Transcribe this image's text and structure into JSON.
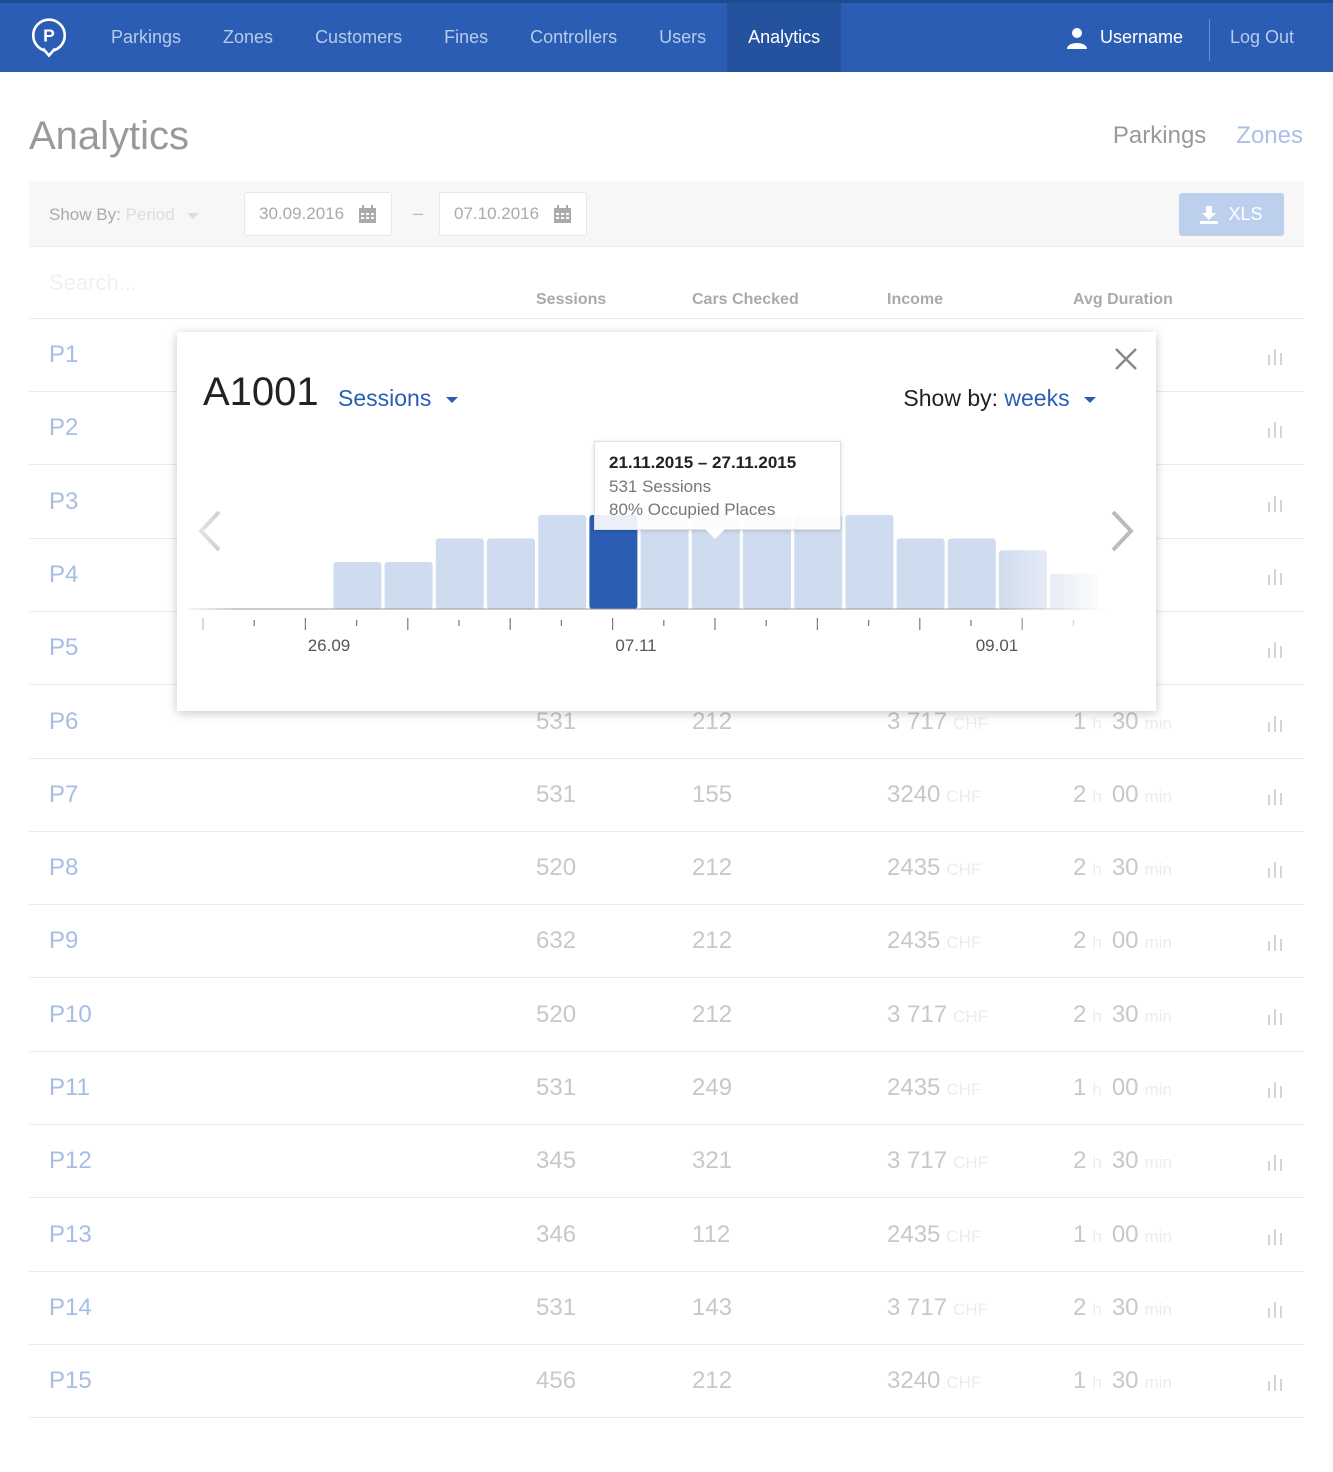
{
  "nav": {
    "items": [
      {
        "label": "Parkings",
        "active": false
      },
      {
        "label": "Zones",
        "active": false
      },
      {
        "label": "Customers",
        "active": false
      },
      {
        "label": "Fines",
        "active": false
      },
      {
        "label": "Controllers",
        "active": false
      },
      {
        "label": "Users",
        "active": false
      },
      {
        "label": "Analytics",
        "active": true
      }
    ],
    "username": "Username",
    "logout": "Log Out",
    "logo_letter": "P"
  },
  "page": {
    "title": "Analytics",
    "views": [
      {
        "label": "Parkings",
        "active": false
      },
      {
        "label": "Zones",
        "active": true
      }
    ]
  },
  "filters": {
    "show_by_label": "Show By:",
    "show_by_value": "Period",
    "date_from": "30.09.2016",
    "date_separator": "–",
    "date_to": "07.10.2016",
    "export_label": "XLS"
  },
  "table": {
    "search_placeholder": "Search...",
    "columns": [
      "Sessions",
      "Cars Checked",
      "Income",
      "Avg Duration"
    ],
    "currency": "CHF",
    "hours_unit": "h",
    "minutes_unit": "min",
    "rows": [
      {
        "name": "P1",
        "sessions": "",
        "cars": "",
        "income": "",
        "hours": "",
        "minutes": ""
      },
      {
        "name": "P2",
        "sessions": "",
        "cars": "",
        "income": "",
        "hours": "",
        "minutes": ""
      },
      {
        "name": "P3",
        "sessions": "",
        "cars": "",
        "income": "",
        "hours": "",
        "minutes": ""
      },
      {
        "name": "P4",
        "sessions": "",
        "cars": "",
        "income": "",
        "hours": "",
        "minutes": ""
      },
      {
        "name": "P5",
        "sessions": "",
        "cars": "",
        "income": "",
        "hours": "",
        "minutes": ""
      },
      {
        "name": "P6",
        "sessions": "531",
        "cars": "212",
        "income": "3 717",
        "hours": "1",
        "minutes": "30"
      },
      {
        "name": "P7",
        "sessions": "531",
        "cars": "155",
        "income": "3240",
        "hours": "2",
        "minutes": "00"
      },
      {
        "name": "P8",
        "sessions": "520",
        "cars": "212",
        "income": "2435",
        "hours": "2",
        "minutes": "30"
      },
      {
        "name": "P9",
        "sessions": "632",
        "cars": "212",
        "income": "2435",
        "hours": "2",
        "minutes": "00"
      },
      {
        "name": "P10",
        "sessions": "520",
        "cars": "212",
        "income": "3 717",
        "hours": "2",
        "minutes": "30"
      },
      {
        "name": "P11",
        "sessions": "531",
        "cars": "249",
        "income": "2435",
        "hours": "1",
        "minutes": "00"
      },
      {
        "name": "P12",
        "sessions": "345",
        "cars": "321",
        "income": "3 717",
        "hours": "2",
        "minutes": "30"
      },
      {
        "name": "P13",
        "sessions": "346",
        "cars": "112",
        "income": "2435",
        "hours": "1",
        "minutes": "00"
      },
      {
        "name": "P14",
        "sessions": "531",
        "cars": "143",
        "income": "3 717",
        "hours": "2",
        "minutes": "30"
      },
      {
        "name": "P15",
        "sessions": "456",
        "cars": "212",
        "income": "3240",
        "hours": "1",
        "minutes": "30"
      }
    ]
  },
  "modal": {
    "title": "A1001",
    "metric": "Sessions",
    "show_by_label": "Show by:",
    "show_by_value": "weeks",
    "tooltip": {
      "range": "21.11.2015 – 27.11.2015",
      "sessions": "531 Sessions",
      "occupied": "80% Occupied Places"
    }
  },
  "chart_data": {
    "type": "bar",
    "highlight_index": 7,
    "values": [
      0,
      0,
      2,
      2,
      3,
      3,
      4,
      4,
      4,
      4,
      4,
      4,
      4,
      3,
      3,
      2.5,
      1.5
    ],
    "tick_labels": [
      "26.09",
      "07.11",
      "09.01"
    ],
    "colors": {
      "bar": "#cfdbee",
      "highlight": "#2a5db3",
      "axis": "#999999"
    }
  }
}
